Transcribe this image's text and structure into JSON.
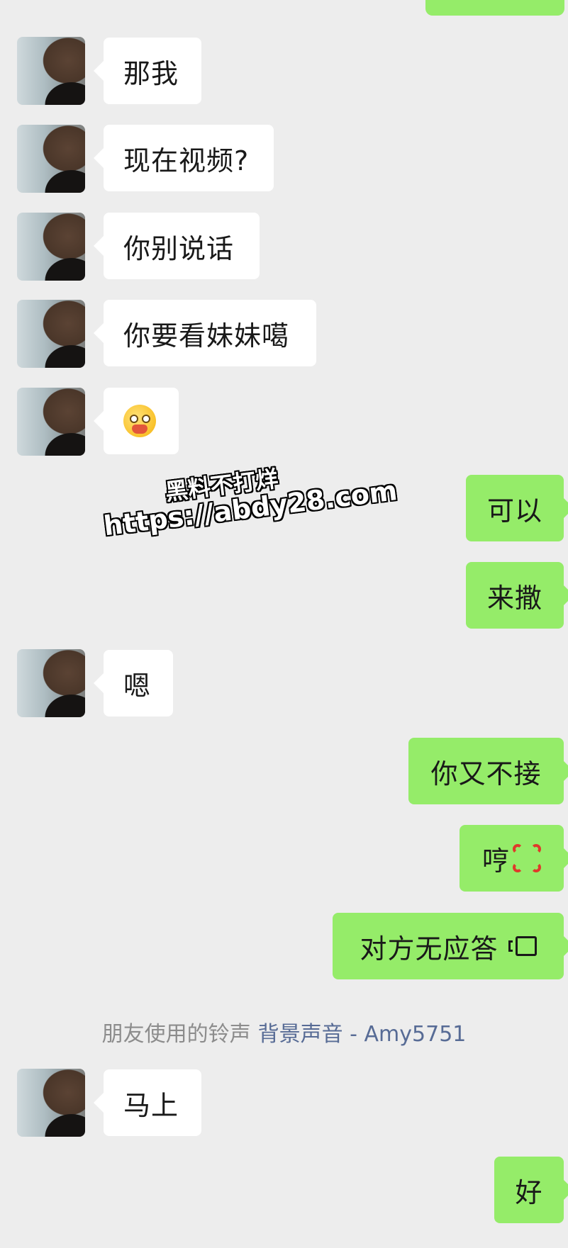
{
  "colors": {
    "background": "#ededed",
    "incoming_bubble": "#ffffff",
    "outgoing_bubble": "#95ec69",
    "system_text": "#8c8c8c",
    "system_link": "#576b95"
  },
  "messages": [
    {
      "side": "in",
      "text": "那我"
    },
    {
      "side": "in",
      "text": "现在视频?"
    },
    {
      "side": "in",
      "text": "你别说话"
    },
    {
      "side": "in",
      "text": "你要看妹妹噶"
    },
    {
      "side": "in",
      "emoji": "blushing-peek-emoji"
    },
    {
      "side": "out",
      "text": "可以"
    },
    {
      "side": "out",
      "text": "来撒"
    },
    {
      "side": "in",
      "text": "嗯"
    },
    {
      "side": "out",
      "text": "你又不接"
    },
    {
      "side": "out",
      "text": "哼",
      "emoji": "anger-symbol-emoji"
    },
    {
      "side": "out",
      "text": "对方无应答",
      "icon": "video-call-icon"
    },
    {
      "side": "in",
      "text": "马上"
    },
    {
      "side": "out",
      "text": "好"
    }
  ],
  "system_notice": {
    "prefix": "朋友使用的铃声",
    "link": "背景声音 - Amy5751"
  },
  "watermark": {
    "line1": "黑料不打烊",
    "line2": "https://abdy28.com"
  }
}
